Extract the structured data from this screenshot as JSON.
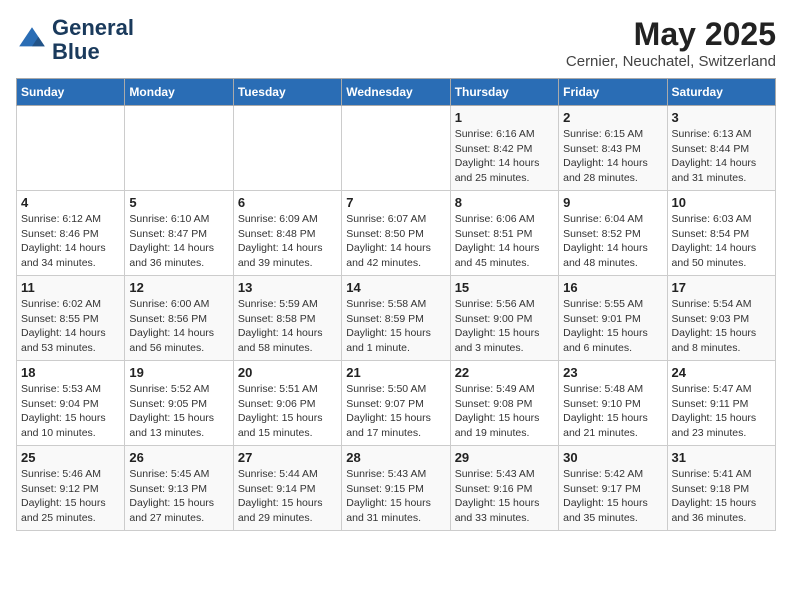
{
  "logo": {
    "line1": "General",
    "line2": "Blue"
  },
  "title": "May 2025",
  "subtitle": "Cernier, Neuchatel, Switzerland",
  "headers": [
    "Sunday",
    "Monday",
    "Tuesday",
    "Wednesday",
    "Thursday",
    "Friday",
    "Saturday"
  ],
  "weeks": [
    [
      {
        "day": "",
        "info": ""
      },
      {
        "day": "",
        "info": ""
      },
      {
        "day": "",
        "info": ""
      },
      {
        "day": "",
        "info": ""
      },
      {
        "day": "1",
        "info": "Sunrise: 6:16 AM\nSunset: 8:42 PM\nDaylight: 14 hours\nand 25 minutes."
      },
      {
        "day": "2",
        "info": "Sunrise: 6:15 AM\nSunset: 8:43 PM\nDaylight: 14 hours\nand 28 minutes."
      },
      {
        "day": "3",
        "info": "Sunrise: 6:13 AM\nSunset: 8:44 PM\nDaylight: 14 hours\nand 31 minutes."
      }
    ],
    [
      {
        "day": "4",
        "info": "Sunrise: 6:12 AM\nSunset: 8:46 PM\nDaylight: 14 hours\nand 34 minutes."
      },
      {
        "day": "5",
        "info": "Sunrise: 6:10 AM\nSunset: 8:47 PM\nDaylight: 14 hours\nand 36 minutes."
      },
      {
        "day": "6",
        "info": "Sunrise: 6:09 AM\nSunset: 8:48 PM\nDaylight: 14 hours\nand 39 minutes."
      },
      {
        "day": "7",
        "info": "Sunrise: 6:07 AM\nSunset: 8:50 PM\nDaylight: 14 hours\nand 42 minutes."
      },
      {
        "day": "8",
        "info": "Sunrise: 6:06 AM\nSunset: 8:51 PM\nDaylight: 14 hours\nand 45 minutes."
      },
      {
        "day": "9",
        "info": "Sunrise: 6:04 AM\nSunset: 8:52 PM\nDaylight: 14 hours\nand 48 minutes."
      },
      {
        "day": "10",
        "info": "Sunrise: 6:03 AM\nSunset: 8:54 PM\nDaylight: 14 hours\nand 50 minutes."
      }
    ],
    [
      {
        "day": "11",
        "info": "Sunrise: 6:02 AM\nSunset: 8:55 PM\nDaylight: 14 hours\nand 53 minutes."
      },
      {
        "day": "12",
        "info": "Sunrise: 6:00 AM\nSunset: 8:56 PM\nDaylight: 14 hours\nand 56 minutes."
      },
      {
        "day": "13",
        "info": "Sunrise: 5:59 AM\nSunset: 8:58 PM\nDaylight: 14 hours\nand 58 minutes."
      },
      {
        "day": "14",
        "info": "Sunrise: 5:58 AM\nSunset: 8:59 PM\nDaylight: 15 hours\nand 1 minute."
      },
      {
        "day": "15",
        "info": "Sunrise: 5:56 AM\nSunset: 9:00 PM\nDaylight: 15 hours\nand 3 minutes."
      },
      {
        "day": "16",
        "info": "Sunrise: 5:55 AM\nSunset: 9:01 PM\nDaylight: 15 hours\nand 6 minutes."
      },
      {
        "day": "17",
        "info": "Sunrise: 5:54 AM\nSunset: 9:03 PM\nDaylight: 15 hours\nand 8 minutes."
      }
    ],
    [
      {
        "day": "18",
        "info": "Sunrise: 5:53 AM\nSunset: 9:04 PM\nDaylight: 15 hours\nand 10 minutes."
      },
      {
        "day": "19",
        "info": "Sunrise: 5:52 AM\nSunset: 9:05 PM\nDaylight: 15 hours\nand 13 minutes."
      },
      {
        "day": "20",
        "info": "Sunrise: 5:51 AM\nSunset: 9:06 PM\nDaylight: 15 hours\nand 15 minutes."
      },
      {
        "day": "21",
        "info": "Sunrise: 5:50 AM\nSunset: 9:07 PM\nDaylight: 15 hours\nand 17 minutes."
      },
      {
        "day": "22",
        "info": "Sunrise: 5:49 AM\nSunset: 9:08 PM\nDaylight: 15 hours\nand 19 minutes."
      },
      {
        "day": "23",
        "info": "Sunrise: 5:48 AM\nSunset: 9:10 PM\nDaylight: 15 hours\nand 21 minutes."
      },
      {
        "day": "24",
        "info": "Sunrise: 5:47 AM\nSunset: 9:11 PM\nDaylight: 15 hours\nand 23 minutes."
      }
    ],
    [
      {
        "day": "25",
        "info": "Sunrise: 5:46 AM\nSunset: 9:12 PM\nDaylight: 15 hours\nand 25 minutes."
      },
      {
        "day": "26",
        "info": "Sunrise: 5:45 AM\nSunset: 9:13 PM\nDaylight: 15 hours\nand 27 minutes."
      },
      {
        "day": "27",
        "info": "Sunrise: 5:44 AM\nSunset: 9:14 PM\nDaylight: 15 hours\nand 29 minutes."
      },
      {
        "day": "28",
        "info": "Sunrise: 5:43 AM\nSunset: 9:15 PM\nDaylight: 15 hours\nand 31 minutes."
      },
      {
        "day": "29",
        "info": "Sunrise: 5:43 AM\nSunset: 9:16 PM\nDaylight: 15 hours\nand 33 minutes."
      },
      {
        "day": "30",
        "info": "Sunrise: 5:42 AM\nSunset: 9:17 PM\nDaylight: 15 hours\nand 35 minutes."
      },
      {
        "day": "31",
        "info": "Sunrise: 5:41 AM\nSunset: 9:18 PM\nDaylight: 15 hours\nand 36 minutes."
      }
    ]
  ]
}
